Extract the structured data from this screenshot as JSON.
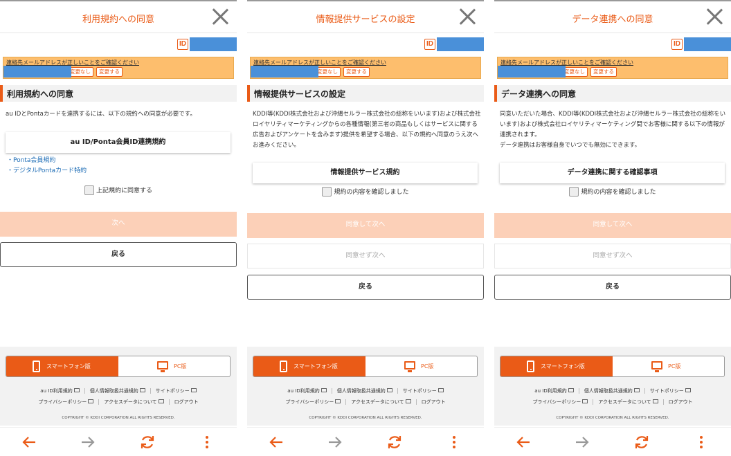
{
  "panels": [
    {
      "header_title": "利用規約への同意",
      "id_badge": "ID",
      "notice": {
        "text": "連絡先メールアドレスが正しいことをご確認ください",
        "btn_no_change": "変更なし",
        "btn_change": "変更する"
      },
      "section_title": "利用規約への同意",
      "body_text": "au IDとPontaカードを連携するには、以下の規約への同意が必要です。",
      "doc_button": "au ID/Ponta会員ID連携規約",
      "links": [
        "・Ponta会員規約",
        "・デジタルPontaカード特約"
      ],
      "checkbox_label": "上記規約に同意する",
      "primary_button": "次へ",
      "back_button": "戻る"
    },
    {
      "header_title": "情報提供サービスの設定",
      "id_badge": "ID",
      "notice": {
        "text": "連絡先メールアドレスが正しいことをご確認ください",
        "btn_no_change": "変更なし",
        "btn_change": "変更する"
      },
      "section_title": "情報提供サービスの設定",
      "body_text": "KDDI等(KDDI株式会社および沖縄セルラー株式会社の総称をいいます)および株式会社ロイヤリティマーケティングからの各種情報(第三者の商品もしくはサービスに関する広告およびアンケートを含みます)提供を希望する場合、以下の規約へ同意のうえ次へお進みください。",
      "doc_button": "情報提供サービス規約",
      "checkbox_label": "規約の内容を確認しました",
      "primary_button": "同意して次へ",
      "secondary_button": "同意せず次へ",
      "back_button": "戻る"
    },
    {
      "header_title": "データ連携への同意",
      "id_badge": "ID",
      "notice": {
        "text": "連絡先メールアドレスが正しいことをご確認ください",
        "btn_no_change": "変更なし",
        "btn_change": "変更する"
      },
      "section_title": "データ連携への同意",
      "body_text_1": "同意いただいた場合、KDDI等(KDDI株式会社および沖縄セルラー株式会社の総称をいいます)および株式会社ロイヤリティマーケティング間でお客様に関する以下の情報が連携されます。",
      "body_text_2": "データ連携はお客様自身でいつでも無効にできます。",
      "doc_button": "データ連携に関する確認事項",
      "checkbox_label": "規約の内容を確認しました",
      "primary_button": "同意して次へ",
      "secondary_button": "同意せず次へ",
      "back_button": "戻る"
    }
  ],
  "footer": {
    "smartphone_label": "スマートフォン版",
    "pc_label": "PC版",
    "links_row1": [
      "au ID利用規約",
      "個人情報取扱共通規約",
      "サイトポリシー"
    ],
    "links_row2": [
      "プライバシーポリシー",
      "アクセスデータについて",
      "ログアウト"
    ],
    "copyright": "COPYRIGHT © KDDI CORPORATION ALL RIGHTS RESERVED."
  },
  "navbar": {
    "icons": [
      "back-arrow-icon",
      "forward-arrow-icon",
      "refresh-icon",
      "more-vertical-icon"
    ]
  },
  "colors": {
    "accent": "#ea5b17",
    "disabled_primary": "#fcd0b8",
    "notice_bg": "#fdbe6d",
    "link": "#1b6bb5",
    "redaction": "#4a90d9"
  }
}
